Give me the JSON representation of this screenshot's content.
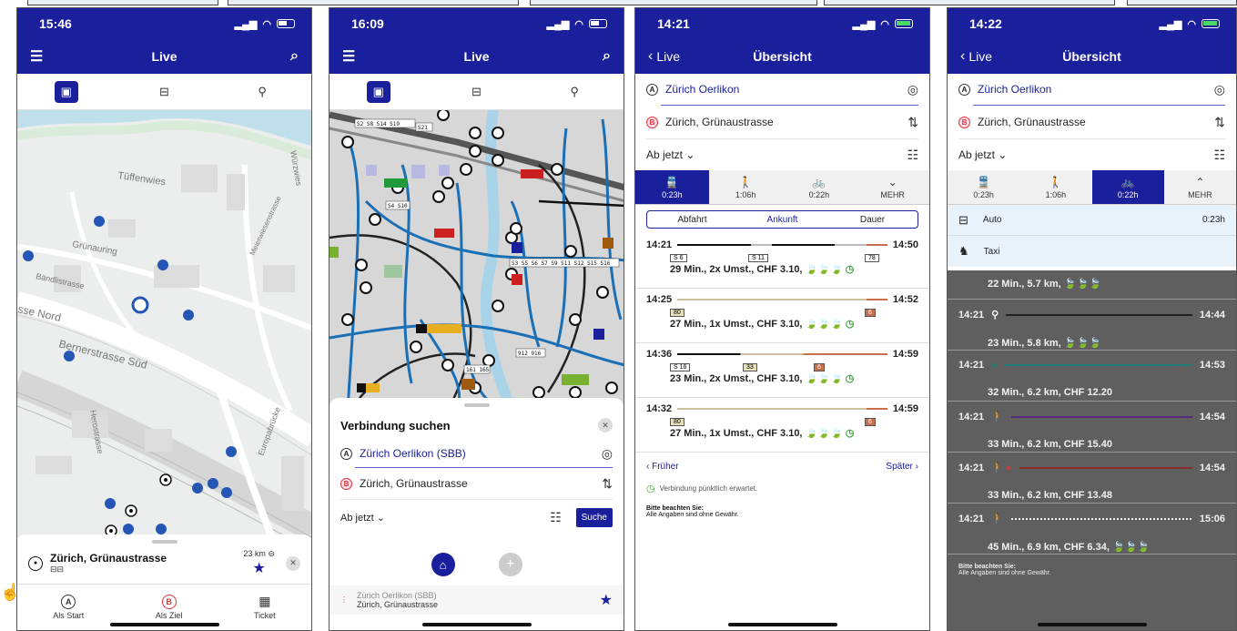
{
  "colors": {
    "brand_blue": "#1a1f9c",
    "map_line": "#2a7fbf",
    "green": "#3aa83a",
    "red": "#d33333"
  },
  "phone1": {
    "time": "15:46",
    "title": "Live",
    "modes": [
      "bus-icon",
      "car-icon",
      "bike-icon"
    ],
    "map_labels": [
      "Tüffenwies",
      "Grünauring",
      "Bändlistrasse",
      "Bernerstrasse Süd",
      "sse Nord",
      "Herostrasse",
      "Europabrücke",
      "Würzwies",
      "Meierwiesenstrasse"
    ],
    "place": {
      "name": "Zürich, Grünaustrasse",
      "distance": "23 km"
    },
    "tabs": [
      {
        "label": "Als Start",
        "glyph": "A"
      },
      {
        "label": "Als Ziel",
        "glyph": "B"
      },
      {
        "label": "Ticket",
        "glyph": "▦"
      }
    ]
  },
  "phone2": {
    "time": "16:09",
    "title": "Live",
    "map_labels": [
      "S2 S8 S14 S19",
      "S21",
      "S4 S10",
      "S3 S5 S6 S7 S9 S11 S12 S15 S16",
      "161 165",
      "912 916"
    ],
    "sheet_title": "Verbindung suchen",
    "from": "Zürich Oerlikon (SBB)",
    "to": "Zürich, Grünaustrasse",
    "time_mode": "Ab jetzt",
    "search_label": "Suche",
    "recent": {
      "from": "Zürich Oerlikon (SBB)",
      "to": "Zürich, Grünaustrasse"
    }
  },
  "phone3": {
    "time": "14:21",
    "back": "Live",
    "title": "Übersicht",
    "from": "Zürich Oerlikon",
    "to": "Zürich, Grünaustrasse",
    "time_mode": "Ab jetzt",
    "tabs": [
      {
        "glyph": "🚆",
        "label": "0:23h"
      },
      {
        "glyph": "🚶",
        "label": "1:06h"
      },
      {
        "glyph": "🚲",
        "label": "0:22h"
      },
      {
        "glyph": "⌄",
        "label": "MEHR"
      }
    ],
    "segments": [
      "Abfahrt",
      "Ankunft",
      "Dauer"
    ],
    "connections": [
      {
        "dep": "14:21",
        "arr": "14:50",
        "chips": [
          "S 6",
          "S 11",
          "78"
        ],
        "info": "29 Min., 2x Umst., CHF 3.10,"
      },
      {
        "dep": "14:25",
        "arr": "14:52",
        "chips": [
          "80",
          "6"
        ],
        "info": "27 Min., 1x Umst., CHF 3.10,"
      },
      {
        "dep": "14:36",
        "arr": "14:59",
        "chips": [
          "S 16",
          "33",
          "6"
        ],
        "info": "23 Min., 2x Umst., CHF 3.10,"
      },
      {
        "dep": "14:32",
        "arr": "14:59",
        "chips": [
          "80",
          "6"
        ],
        "info": "27 Min., 1x Umst., CHF 3.10,"
      }
    ],
    "earlier": "Früher",
    "later": "Später",
    "punctual": "Verbindung pünktlich erwartet.",
    "note_title": "Bitte beachten Sie:",
    "note_text": "Alle Angaben sind ohne Gewähr."
  },
  "phone4": {
    "time": "14:22",
    "back": "Live",
    "title": "Übersicht",
    "from": "Zürich Oerlikon",
    "to": "Zürich, Grünaustrasse",
    "time_mode": "Ab jetzt",
    "tabs": [
      {
        "glyph": "🚆",
        "label": "0:23h"
      },
      {
        "glyph": "🚶",
        "label": "1:06h"
      },
      {
        "glyph": "🚲",
        "label": "0:22h"
      },
      {
        "glyph": "⌃",
        "label": "MEHR"
      }
    ],
    "more_options": [
      {
        "label": "Auto",
        "value": "0:23h"
      },
      {
        "label": "Taxi",
        "value": ""
      }
    ],
    "rows": [
      {
        "dep": "",
        "arr": "",
        "info": "22 Min., 5.7 km,",
        "bar": "#222222"
      },
      {
        "dep": "14:21",
        "arr": "14:44",
        "info": "23 Min., 5.8 km,",
        "bar": "#222222"
      },
      {
        "dep": "14:21",
        "arr": "14:53",
        "info": "32 Min., 6.2 km, CHF 12.20",
        "bar": "#1f7a7a"
      },
      {
        "dep": "14:21",
        "arr": "14:54",
        "info": "33 Min., 6.2 km, CHF 15.40",
        "bar": "#5a2a7a"
      },
      {
        "dep": "14:21",
        "arr": "14:54",
        "info": "33 Min., 6.2 km, CHF 13.48",
        "bar": "#8a2e2e"
      },
      {
        "dep": "14:21",
        "arr": "15:06",
        "info": "45 Min., 6.9 km, CHF 6.34,",
        "bar": "#5a2a7a"
      }
    ],
    "note_title": "Bitte beachten Sie:",
    "note_text": "Alle Angaben sind ohne Gewähr."
  }
}
